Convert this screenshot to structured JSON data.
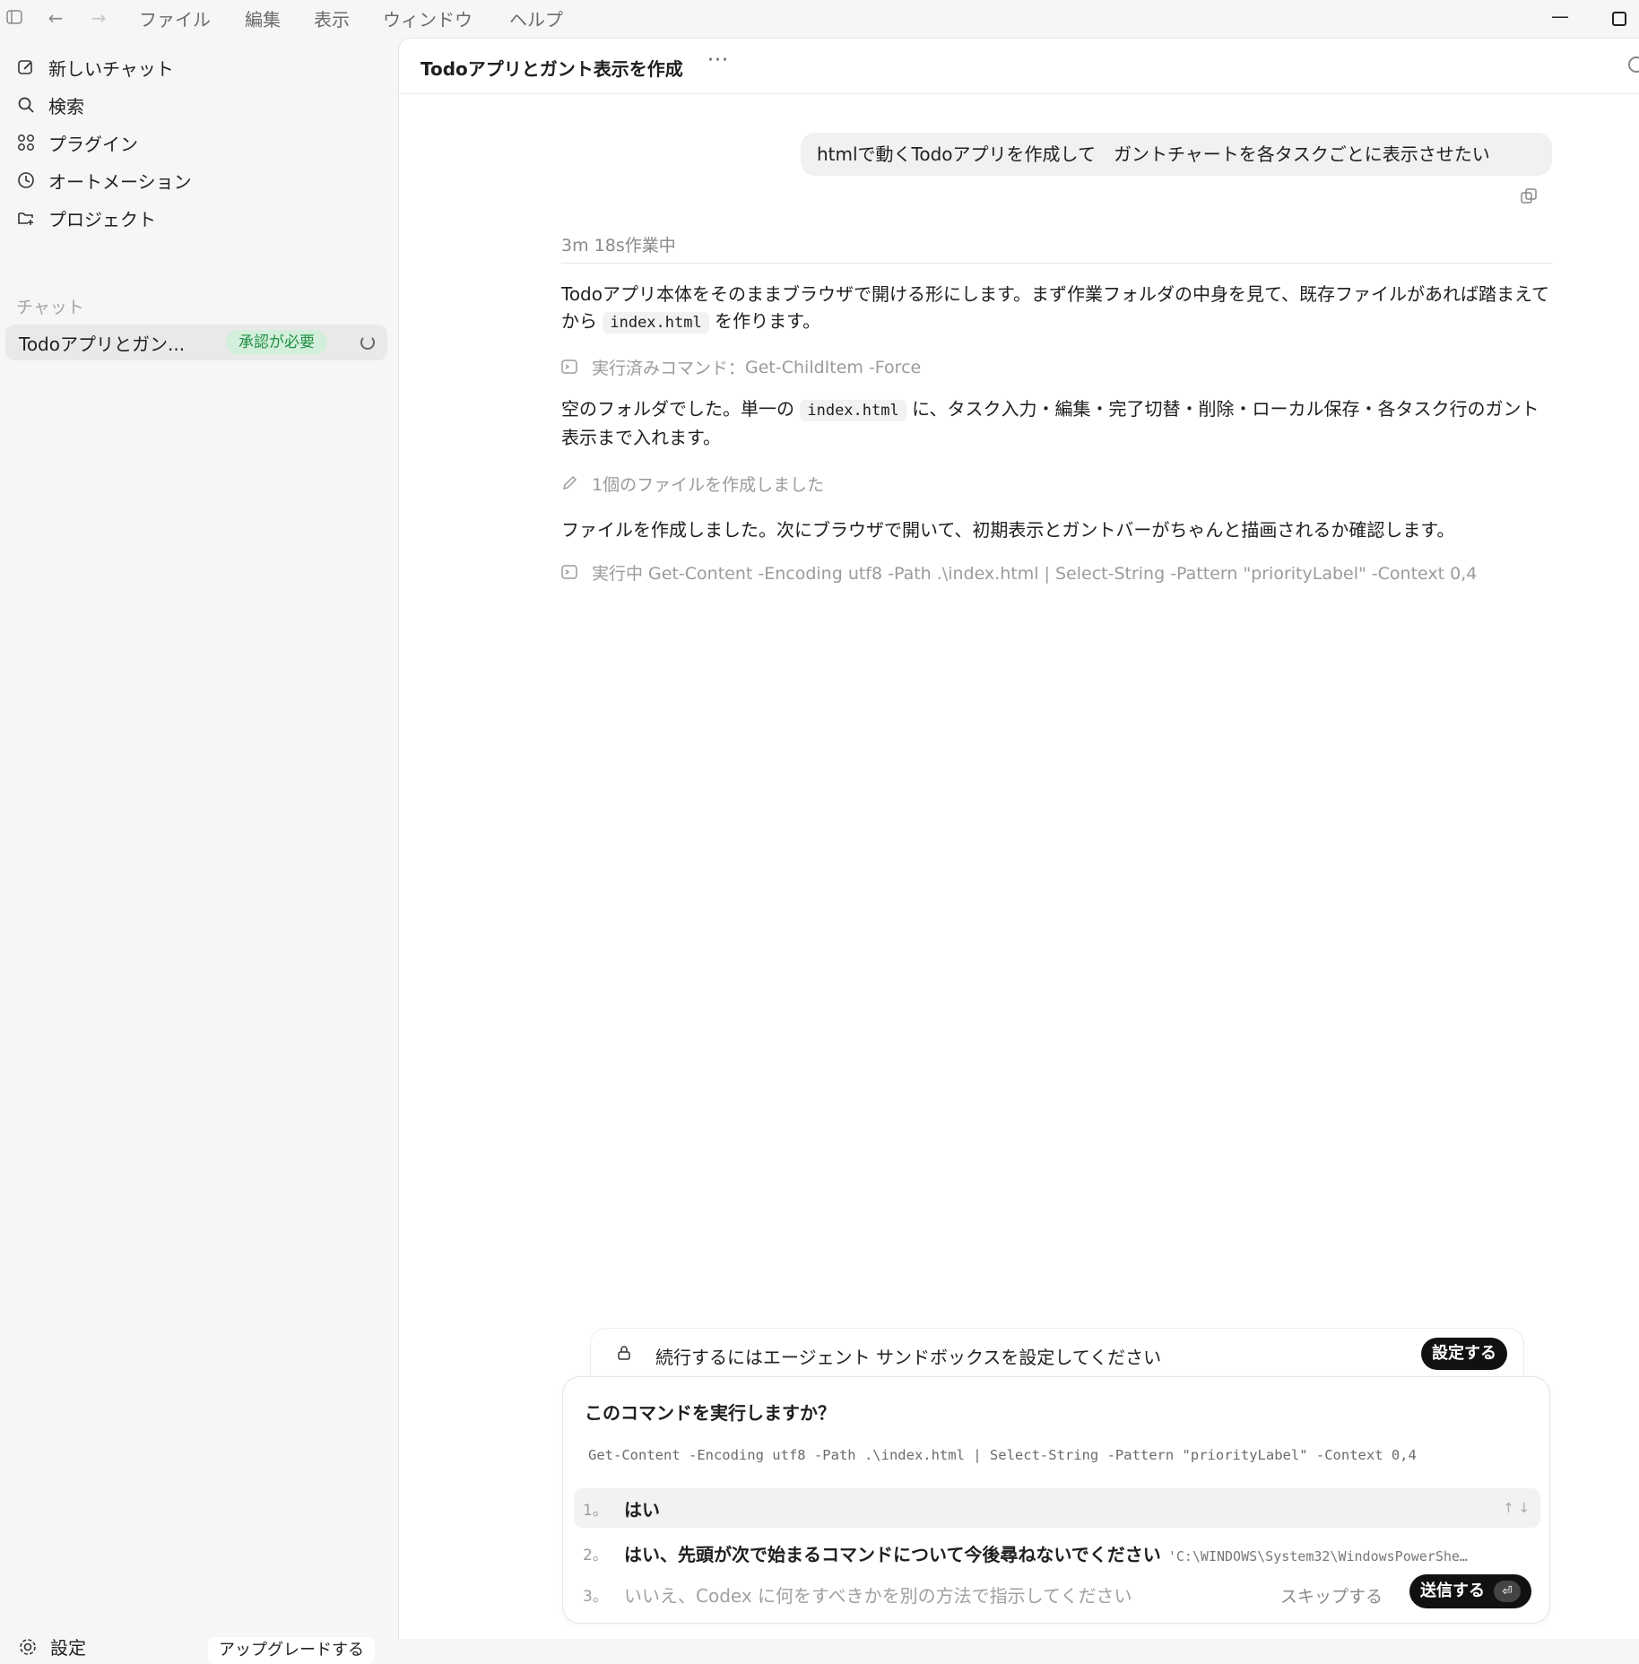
{
  "menubar": {
    "items": [
      "ファイル",
      "編集",
      "表示",
      "ウィンドウ",
      "ヘルプ"
    ]
  },
  "sidebar": {
    "nav": [
      {
        "label": "新しいチャット",
        "icon": "edit-icon"
      },
      {
        "label": "検索",
        "icon": "search-icon"
      },
      {
        "label": "プラグイン",
        "icon": "grid-icon"
      },
      {
        "label": "オートメーション",
        "icon": "clock-icon"
      },
      {
        "label": "プロジェクト",
        "icon": "folder-plus-icon"
      }
    ],
    "section_label": "チャット",
    "chat": {
      "title": "Todoアプリとガン...",
      "badge": "承認が必要"
    },
    "settings_label": "設定",
    "upgrade_label": "アップグレードする"
  },
  "header": {
    "title": "Todoアプリとガント表示を作成",
    "more": "···"
  },
  "conversation": {
    "user_message": "htmlで動くTodoアプリを作成して　ガントチャートを各タスクごとに表示させたい",
    "work_time": "3m 18s作業中",
    "para1_a": "Todoアプリ本体をそのままブラウザで開ける形にします。まず作業フォルダの中身を見て、既存ファイルがあれば踏まえてから",
    "para1_code": "index.html",
    "para1_b": "を作ります。",
    "cmd1_label": "実行済みコマンド：",
    "cmd1_value": "Get-ChildItem -Force",
    "para2_a": "空のフォルダでした。単一の",
    "para2_code": "index.html",
    "para2_b": "に、タスク入力・編集・完了切替・削除・ローカル保存・各タスク行のガント表示まで入れます。",
    "file_created": "1個のファイルを作成しました",
    "para3": "ファイルを作成しました。次にブラウザで開いて、初期表示とガントバーがちゃんと描画されるか確認します。",
    "cmd2": "実行中 Get-Content -Encoding utf8 -Path .\\index.html | Select-String -Pattern \"priorityLabel\" -Context 0,4"
  },
  "sandbox": {
    "message": "続行するにはエージェント サンドボックスを設定してください",
    "button": "設定する"
  },
  "approval": {
    "question": "このコマンドを実行しますか？",
    "command": "Get-Content -Encoding utf8 -Path .\\index.html | Select-String -Pattern \"priorityLabel\" -Context 0,4",
    "options": [
      {
        "num": "1。",
        "label": "はい"
      },
      {
        "num": "2。",
        "label": "はい、先頭が次で始まるコマンドについて今後尋ねないでください",
        "extra": "'C:\\WINDOWS\\System32\\WindowsPowerShe…"
      },
      {
        "num": "3。",
        "label": "いいえ、Codex に何をすべきかを別の方法で指示してください"
      }
    ],
    "skip_label": "スキップする",
    "send_label": "送信する",
    "send_key": "⏎"
  }
}
